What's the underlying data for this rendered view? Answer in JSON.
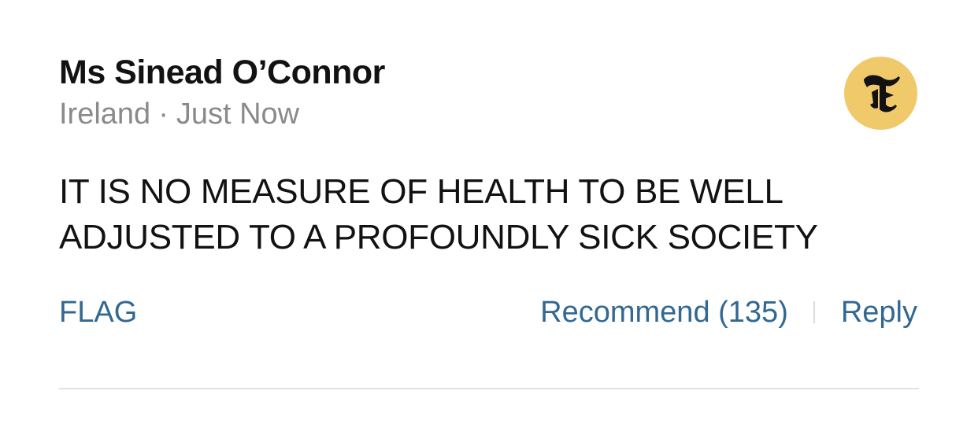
{
  "comment": {
    "author": "Ms Sinead O’Connor",
    "location": "Ireland",
    "separator": "·",
    "time": "Just Now",
    "body": "IT IS NO MEASURE OF HEALTH TO BE WELL ADJUSTED TO A PROFOUNDLY SICK SOCIETY",
    "avatar_icon": "nyt-logo-icon",
    "avatar_color": "#f0c96a"
  },
  "actions": {
    "flag_label": "FLAG",
    "recommend_label": "Recommend (135)",
    "reply_label": "Reply",
    "link_color": "#326891"
  }
}
